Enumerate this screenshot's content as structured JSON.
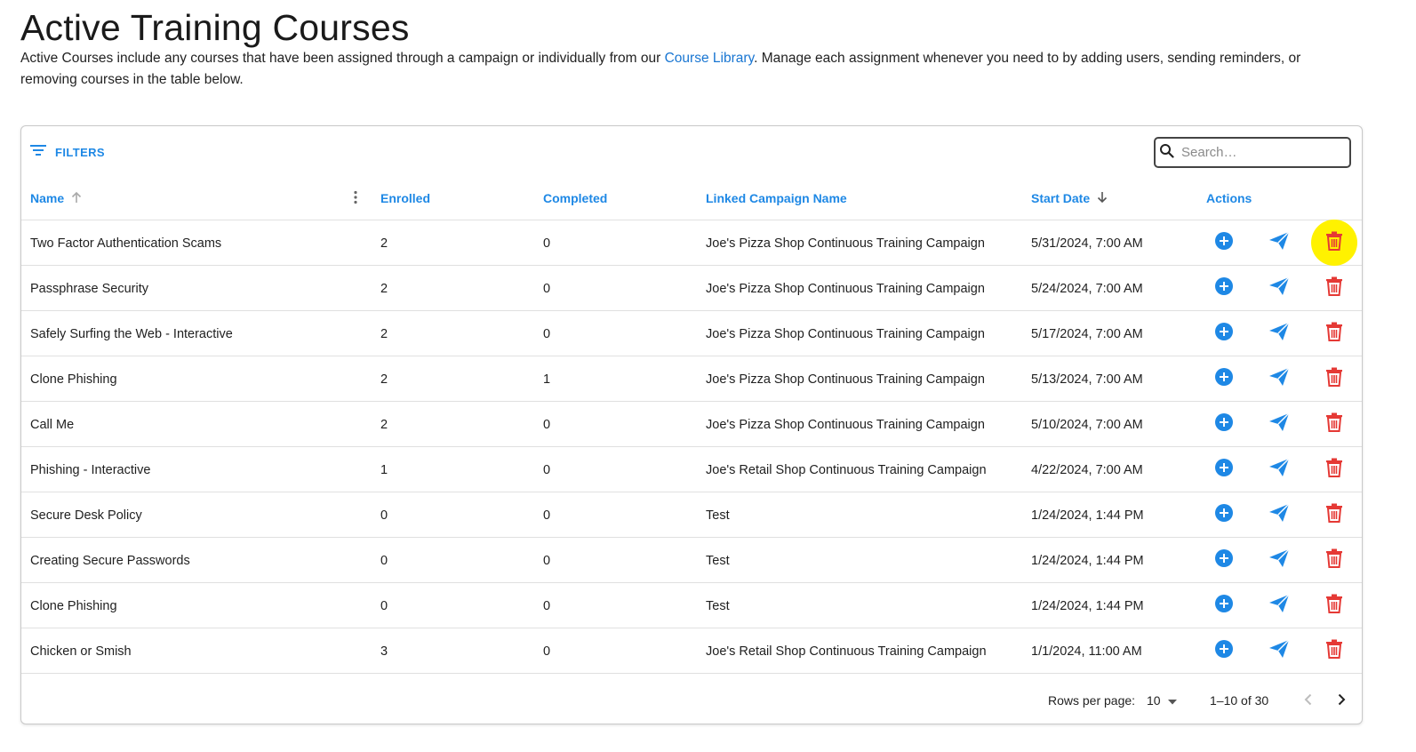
{
  "page": {
    "title": "Active Training Courses",
    "desc_before": "Active Courses include any courses that have been assigned through a campaign or individually from our ",
    "desc_link": "Course Library",
    "desc_after": ". Manage each assignment whenever you need to by adding users, sending reminders, or removing courses in the table below."
  },
  "toolbar": {
    "filters_label": "FILTERS",
    "search_placeholder": "Search…"
  },
  "columns": {
    "name": "Name",
    "enrolled": "Enrolled",
    "completed": "Completed",
    "campaign": "Linked Campaign Name",
    "start_date": "Start Date",
    "actions": "Actions"
  },
  "rows": [
    {
      "name": "Two Factor Authentication Scams",
      "enrolled": "2",
      "completed": "0",
      "campaign": "Joe's Pizza Shop Continuous Training Campaign",
      "start_date": "5/31/2024, 7:00 AM"
    },
    {
      "name": "Passphrase Security",
      "enrolled": "2",
      "completed": "0",
      "campaign": "Joe's Pizza Shop Continuous Training Campaign",
      "start_date": "5/24/2024, 7:00 AM"
    },
    {
      "name": "Safely Surfing the Web - Interactive",
      "enrolled": "2",
      "completed": "0",
      "campaign": "Joe's Pizza Shop Continuous Training Campaign",
      "start_date": "5/17/2024, 7:00 AM"
    },
    {
      "name": "Clone Phishing",
      "enrolled": "2",
      "completed": "1",
      "campaign": "Joe's Pizza Shop Continuous Training Campaign",
      "start_date": "5/13/2024, 7:00 AM"
    },
    {
      "name": "Call Me",
      "enrolled": "2",
      "completed": "0",
      "campaign": "Joe's Pizza Shop Continuous Training Campaign",
      "start_date": "5/10/2024, 7:00 AM"
    },
    {
      "name": "Phishing - Interactive",
      "enrolled": "1",
      "completed": "0",
      "campaign": "Joe's Retail Shop Continuous Training Campaign",
      "start_date": "4/22/2024, 7:00 AM"
    },
    {
      "name": "Secure Desk Policy",
      "enrolled": "0",
      "completed": "0",
      "campaign": "Test",
      "start_date": "1/24/2024, 1:44 PM"
    },
    {
      "name": "Creating Secure Passwords",
      "enrolled": "0",
      "completed": "0",
      "campaign": "Test",
      "start_date": "1/24/2024, 1:44 PM"
    },
    {
      "name": "Clone Phishing",
      "enrolled": "0",
      "completed": "0",
      "campaign": "Test",
      "start_date": "1/24/2024, 1:44 PM"
    },
    {
      "name": "Chicken or Smish",
      "enrolled": "3",
      "completed": "0",
      "campaign": "Joe's Retail Shop Continuous Training Campaign",
      "start_date": "1/1/2024, 11:00 AM"
    }
  ],
  "pagination": {
    "rows_per_page_label": "Rows per page:",
    "rows_per_page_value": "10",
    "range": "1–10 of 30"
  },
  "colors": {
    "accent": "#1e88e5",
    "delete": "#e53935",
    "highlight": "#fff200"
  },
  "icons": {
    "add": "add-circle-icon",
    "send": "paper-plane-icon",
    "delete": "trash-icon",
    "filter": "filter-list-icon",
    "search": "search-icon"
  }
}
